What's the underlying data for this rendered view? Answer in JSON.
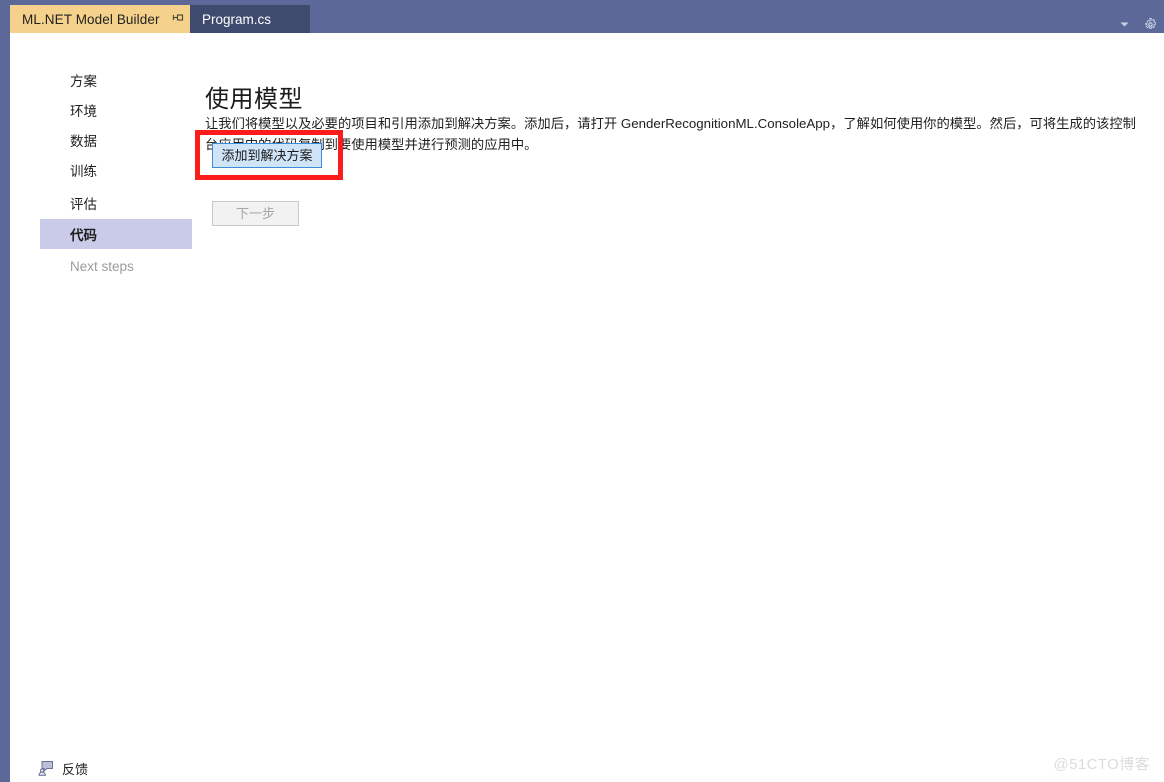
{
  "window": {
    "chrome_color": "#5b6898",
    "page_background": "#ffffff"
  },
  "tabs": [
    {
      "id": "ml-net-model-builder",
      "label": "ML.NET Model Builder",
      "active": true,
      "background": "#f5d28c",
      "pin_icon": "pin-icon",
      "close_icon": "close-icon"
    },
    {
      "id": "program-cs",
      "label": "Program.cs",
      "active": false,
      "background": "#3f4a6f"
    }
  ],
  "tabstrip_controls": [
    {
      "name": "tab-list-dropdown",
      "icon": "chevron-down-icon"
    },
    {
      "name": "tab-options",
      "icon": "gear-icon"
    }
  ],
  "sidebar": {
    "items": [
      {
        "label": "方案",
        "state": "normal"
      },
      {
        "label": "环境",
        "state": "normal"
      },
      {
        "label": "数据",
        "state": "normal"
      },
      {
        "label": "训练",
        "state": "normal"
      },
      {
        "label": "评估",
        "state": "normal"
      },
      {
        "label": "代码",
        "state": "selected"
      },
      {
        "label": "Next steps",
        "state": "disabled"
      }
    ],
    "selected_background": "#c9cbe8"
  },
  "main": {
    "title": "使用模型",
    "description": "让我们将模型以及必要的项目和引用添加到解决方案。添加后，请打开 GenderRecognitionML.ConsoleApp，了解如何使用你的模型。然后，可将生成的该控制台应用中的代码复制到要使用模型并进行预测的应用中。",
    "add_to_solution_label": "添加到解决方案",
    "next_step_label": "下一步",
    "next_step_disabled": true,
    "highlight_color": "#fc1c1c",
    "primary_button_border": "#3a8ddb",
    "primary_button_fill": "#cfe4f7"
  },
  "footer": {
    "feedback_label": "反馈",
    "feedback_icon": "feedback-icon"
  },
  "watermark": {
    "text": "@51CTO博客"
  }
}
